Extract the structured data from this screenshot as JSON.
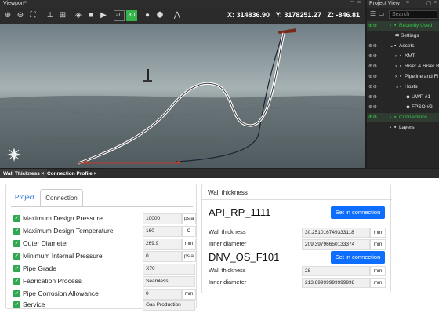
{
  "viewport": {
    "title": "Viewport",
    "toggle_2d": "2D",
    "toggle_3d": "3D",
    "coords": {
      "x": "X: 314836.90",
      "y": "Y: 3178251.27",
      "z": "Z: -846.81"
    }
  },
  "project_view": {
    "title": "Project View",
    "search_placeholder": "Search",
    "items": [
      {
        "label": "Recently Used"
      },
      {
        "label": "Settings"
      },
      {
        "label": "Assets"
      },
      {
        "label": "XMT"
      },
      {
        "label": "Riser & Riser B"
      },
      {
        "label": "Pipeline and Fl"
      },
      {
        "label": "Hosts"
      },
      {
        "label": "UWP #1"
      },
      {
        "label": "FPSO #2"
      },
      {
        "label": "Connections"
      },
      {
        "label": "Layers"
      }
    ]
  },
  "bottom_tabs": [
    {
      "label": "Wall Thickness"
    },
    {
      "label": "Connection Profile"
    }
  ],
  "left_panel": {
    "tabs": [
      {
        "label": "Project"
      },
      {
        "label": "Connection"
      }
    ],
    "rows": [
      {
        "label": "Maximum Design Pressure",
        "value": "10000",
        "unit": "psia"
      },
      {
        "label": "Maximum Design Temperature",
        "value": "160",
        "unit": "C"
      },
      {
        "label": "Outer Diameter",
        "value": "269.9",
        "unit": "mm"
      },
      {
        "label": "Minimum Internal Pressure",
        "value": "0",
        "unit": "psia"
      },
      {
        "label": "Pipe Grade",
        "value": "X70",
        "unit": ""
      },
      {
        "label": "Fabrication Process",
        "value": "Seamless",
        "unit": ""
      },
      {
        "label": "Pipe Corrosion Allowance",
        "value": "0",
        "unit": "mm"
      },
      {
        "label": "Service",
        "value": "Gas Production",
        "unit": ""
      }
    ]
  },
  "wall_thickness": {
    "title": "Wall thickness",
    "standards": [
      {
        "name": "API_RP_1111",
        "button": "Set in connection",
        "wt_label": "Wall thickness",
        "wt_value": "30.251016749333118",
        "wt_unit": "mm",
        "id_label": "Inner diameter",
        "id_value": "209.39796650133374",
        "id_unit": "mm"
      },
      {
        "name": "DNV_OS_F101",
        "button": "Set in connection",
        "wt_label": "Wall thickness",
        "wt_value": "28",
        "wt_unit": "mm",
        "id_label": "Inner diameter",
        "id_value": "213.89999999999998",
        "id_unit": "mm"
      }
    ]
  }
}
